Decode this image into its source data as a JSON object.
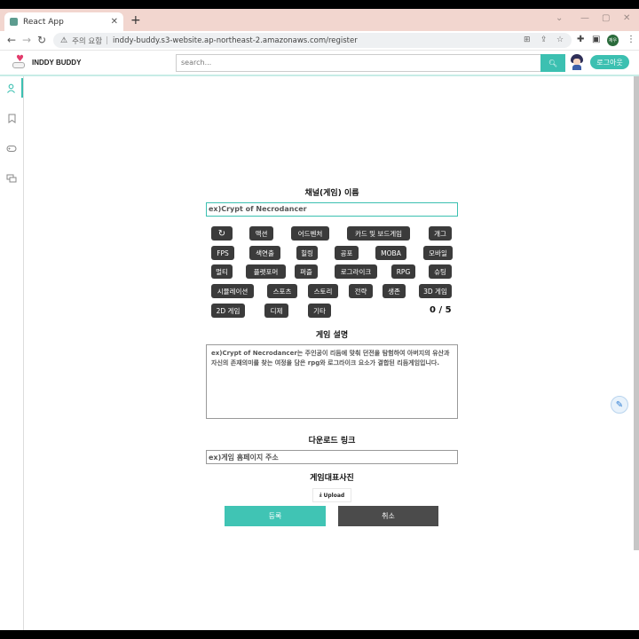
{
  "browser": {
    "tab_title": "React App",
    "tab_close": "✕",
    "new_tab": "+",
    "win_min": "⌄",
    "win_minimize": "—",
    "win_restore": "▢",
    "win_close": "✕",
    "security_warning": "주의 요함",
    "url": "inddy-buddy.s3-website.ap-northeast-2.amazonaws.com/register",
    "profile_initial": "재우"
  },
  "header": {
    "logo_text": "INDDY BUDDY",
    "search_placeholder": "search...",
    "logout_label": "로그아웃"
  },
  "form": {
    "name_title": "채널(게임) 이름",
    "name_placeholder": "ex)Crypt of Necrodancer",
    "genres": [
      "액션",
      "어드벤처",
      "카드 및 보드게임",
      "개그",
      "FPS",
      "색연출",
      "힐링",
      "공포",
      "MOBA",
      "모바일",
      "멀티",
      "플랫포머",
      "퍼즐",
      "로그라이크",
      "RPG",
      "슈팅",
      "시뮬레이션",
      "스포츠",
      "스토리",
      "전략",
      "생존",
      "3D 게임",
      "2D 게임",
      "디제",
      "기타"
    ],
    "selected_count": "0 / 5",
    "desc_title": "게임 설명",
    "desc_placeholder": "ex)Crypt of Necrodancer는 주인공이 리듬에 맞춰 던전을 탐험하여 아버지의 유산과 자신의 존재의미를 찾는 여정을 담은 rpg와 로그라이크 요소가 결합된 리듬게임입니다.",
    "download_title": "다운로드 링크",
    "download_placeholder": "ex)게임 홈페이지 주소",
    "image_title": "게임대표사진",
    "upload_label": "Upload",
    "submit_label": "등록",
    "cancel_label": "취소"
  }
}
